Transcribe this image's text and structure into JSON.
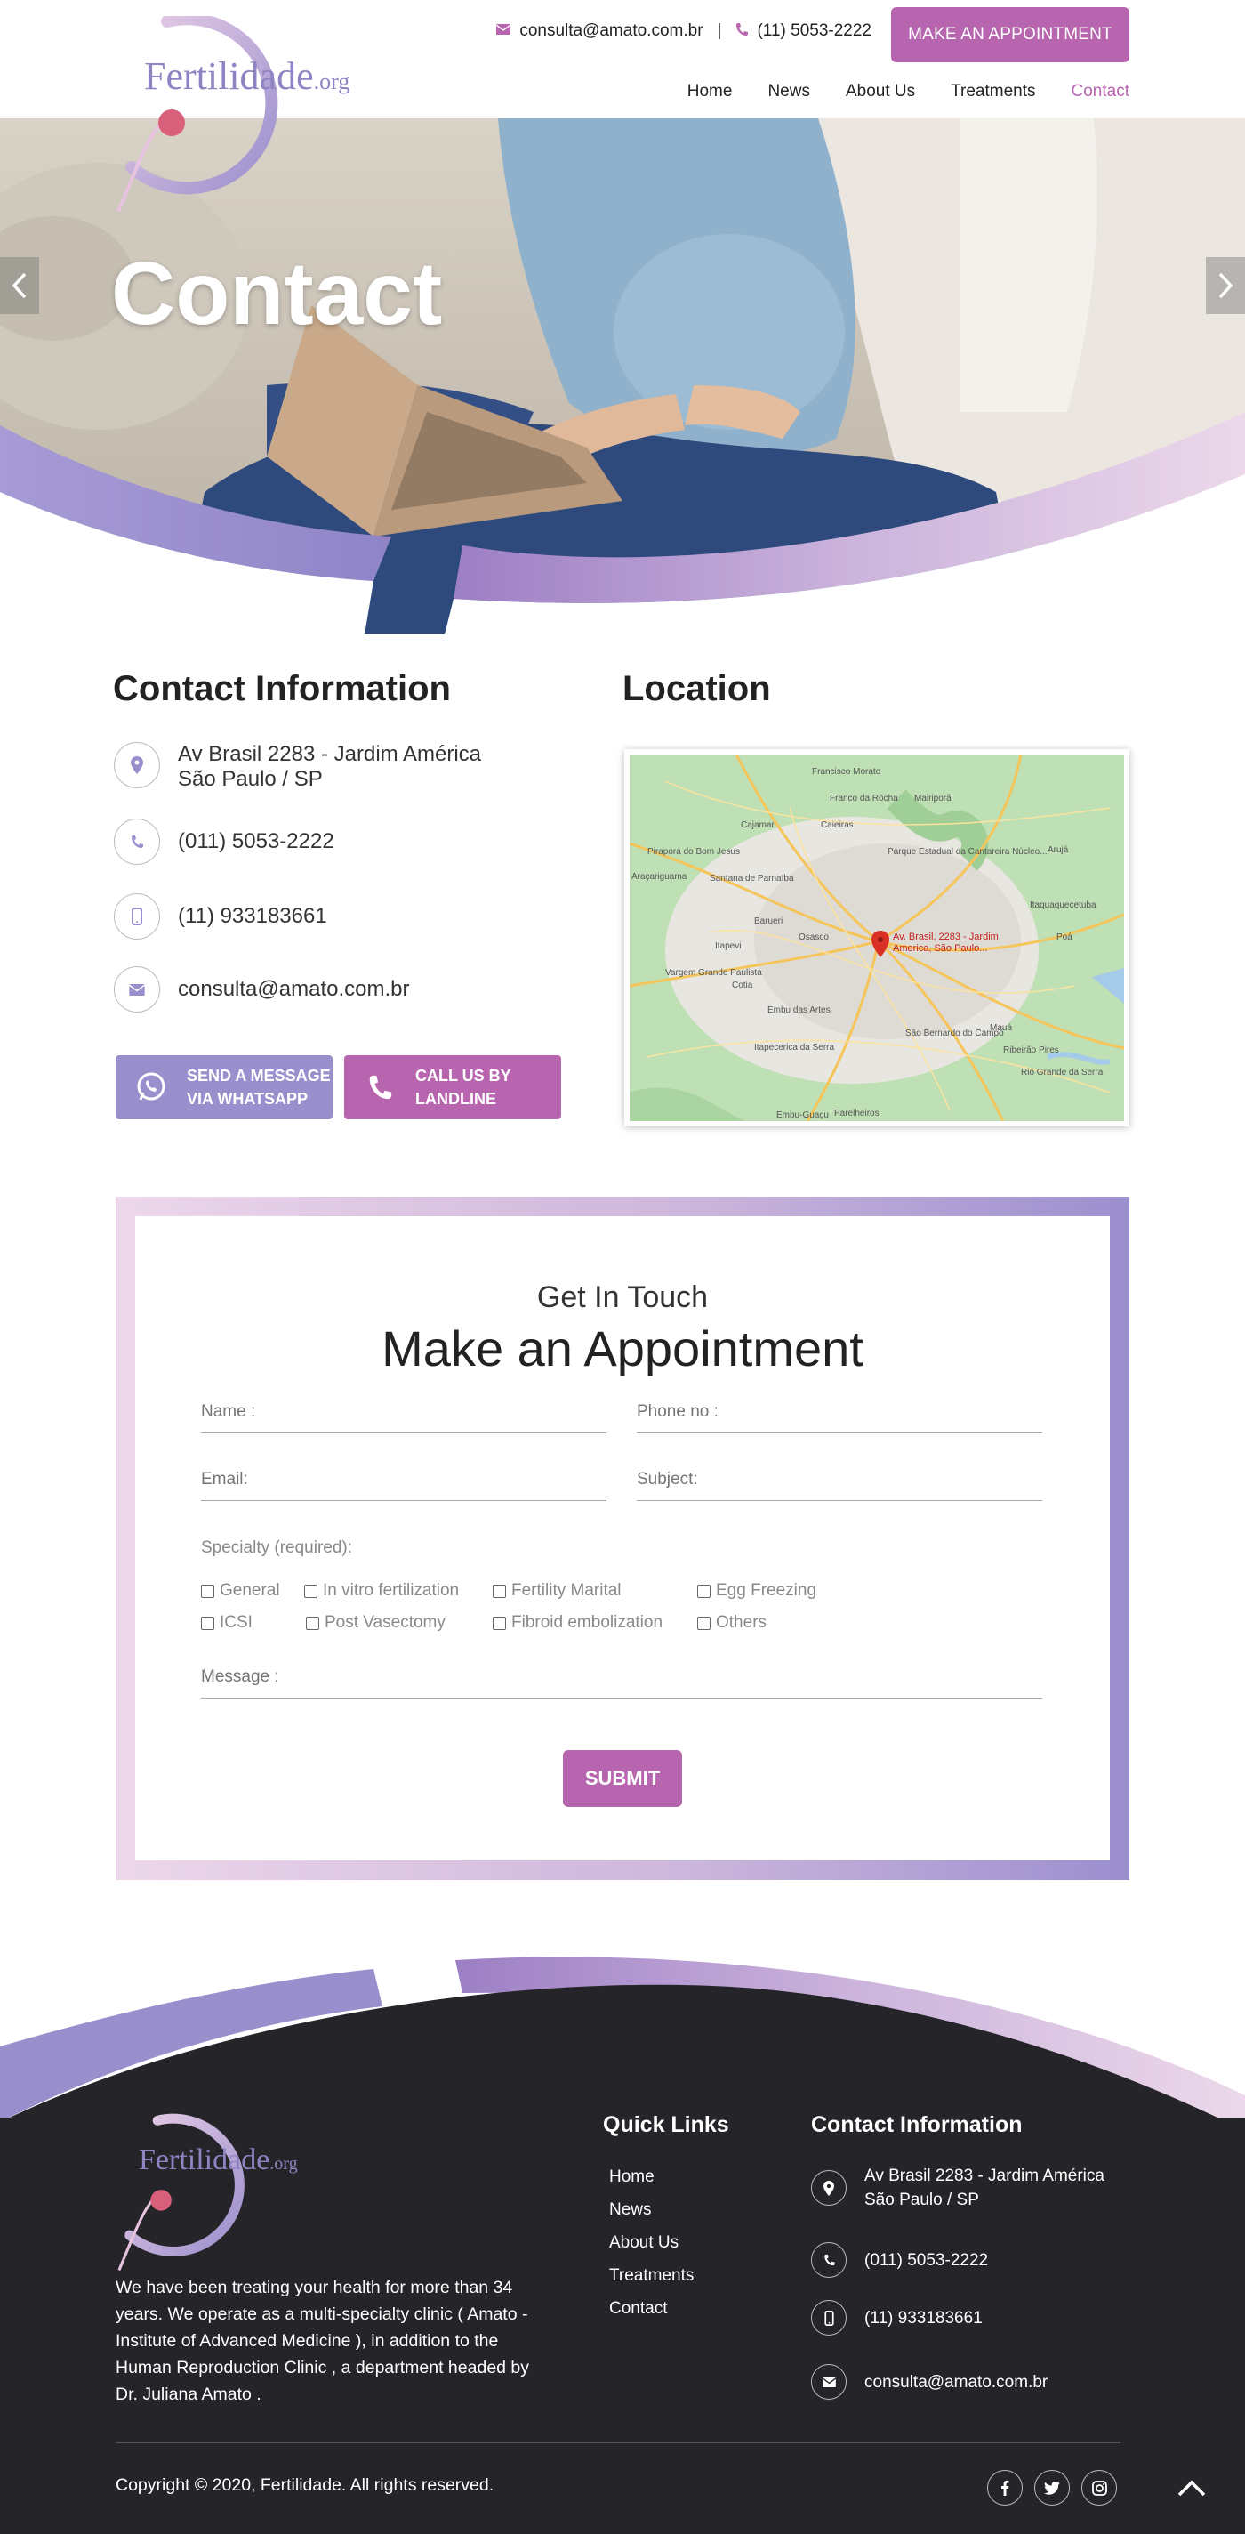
{
  "header": {
    "logo_text": "Fertilidade",
    "logo_suffix": ".org",
    "email": "consulta@amato.com.br",
    "phone": "(11) 5053-2222",
    "separator": "|",
    "appointment_button": "MAKE AN APPOINTMENT",
    "nav": [
      {
        "label": "Home",
        "active": false
      },
      {
        "label": "News",
        "active": false
      },
      {
        "label": "About Us",
        "active": false
      },
      {
        "label": "Treatments",
        "active": false
      },
      {
        "label": "Contact",
        "active": true
      }
    ]
  },
  "hero": {
    "title": "Contact",
    "prev_arrow": "‹",
    "next_arrow": "›"
  },
  "contact_info": {
    "title": "Contact Information",
    "address_line1": "Av Brasil 2283 - Jardim América",
    "address_line2": "São Paulo / SP",
    "phone": "(011) 5053-2222",
    "mobile": "(11) 933183661",
    "email": "consulta@amato.com.br",
    "whatsapp_line1": "SEND A MESSAGE",
    "whatsapp_line2": "VIA WHATSAPP",
    "landline_line1": "CALL US BY",
    "landline_line2": "LANDLINE"
  },
  "location": {
    "title": "Location",
    "marker_label_line1": "Av. Brasil, 2283 - Jardim",
    "marker_label_line2": "America, São Paulo...",
    "map_places": [
      {
        "label": "Francisco Morato"
      },
      {
        "label": "Franco da Rocha"
      },
      {
        "label": "Mairiporã"
      },
      {
        "label": "Cajamar"
      },
      {
        "label": "Caieiras"
      },
      {
        "label": "Pirapora do Bom Jesus"
      },
      {
        "label": "Parque Estadual da Cantareira Núcleo..."
      },
      {
        "label": "Santana de Parnaíba"
      },
      {
        "label": "Arujá"
      },
      {
        "label": "Araçariguama"
      },
      {
        "label": "Barueri"
      },
      {
        "label": "Itaquaquecetuba"
      },
      {
        "label": "Osasco"
      },
      {
        "label": "Itapevi"
      },
      {
        "label": "Poá"
      },
      {
        "label": "Vargem Grande Paulista"
      },
      {
        "label": "Cotia"
      },
      {
        "label": "Embu das Artes"
      },
      {
        "label": "São Bernardo do Campo"
      },
      {
        "label": "Mauá"
      },
      {
        "label": "Ribeirão Pires"
      },
      {
        "label": "Itapecerica da Serra"
      },
      {
        "label": "Rio Grande da Serra"
      },
      {
        "label": "Embu-Guaçu"
      },
      {
        "label": "Parelheiros"
      }
    ]
  },
  "form": {
    "subtitle": "Get In Touch",
    "title": "Make an Appointment",
    "name_placeholder": "Name :",
    "phone_placeholder": "Phone no :",
    "email_placeholder": "Email:",
    "subject_placeholder": "Subject:",
    "specialty_label": "Specialty (required):",
    "specialties": [
      "General",
      "In vitro fertilization",
      "Fertility Marital",
      "Egg Freezing",
      "ICSI",
      "Post Vasectomy",
      "Fibroid embolization",
      "Others"
    ],
    "message_placeholder": "Message :",
    "submit": "SUBMIT"
  },
  "footer": {
    "logo_text": "Fertilidade",
    "logo_suffix": ".org",
    "about": "We have been treating your health for more than 34 years. We operate as a multi-specialty clinic ( Amato - Institute of Advanced Medicine ), in addition to the Human Reproduction Clinic , a department headed by Dr. Juliana Amato .",
    "quick_links_title": "Quick Links",
    "quick_links": [
      "Home",
      "News",
      "About Us",
      "Treatments",
      "Contact"
    ],
    "contact_title": "Contact Information",
    "address_line1": "Av Brasil 2283 - Jardim América",
    "address_line2": "São Paulo / SP",
    "phone": "(011) 5053-2222",
    "mobile": "(11) 933183661",
    "email": "consulta@amato.com.br",
    "copyright": "Copyright © 2020, Fertilidade. All rights reserved.",
    "social": [
      "facebook-icon",
      "twitter-icon",
      "instagram-icon"
    ]
  },
  "colors": {
    "accent": "#b865b0",
    "lavender": "#9a8fcd",
    "footer_bg": "#252428"
  }
}
